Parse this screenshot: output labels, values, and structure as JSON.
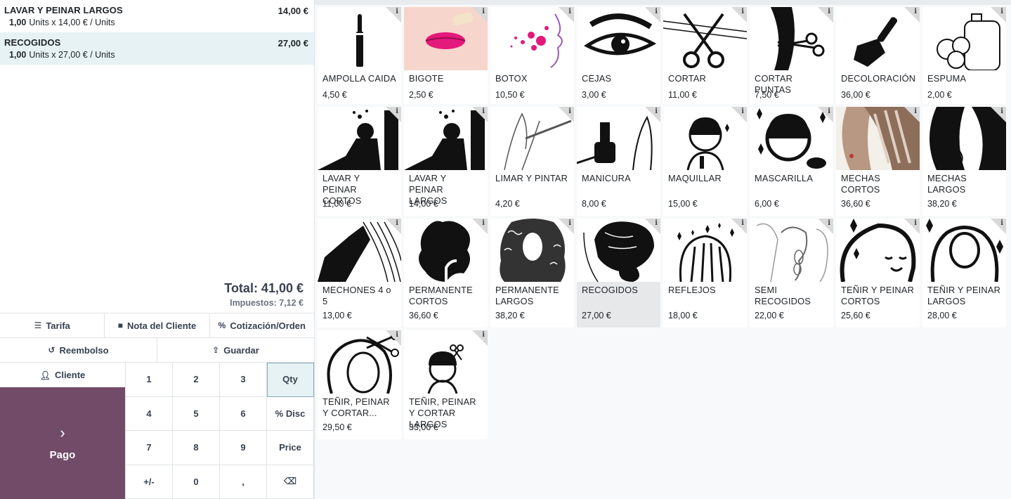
{
  "order": {
    "lines": [
      {
        "name": "LAVAR Y PEINAR LARGOS",
        "price": "14,00 €",
        "qty": "1,00",
        "detail": "Units x 14,00 € / Units",
        "selected": false
      },
      {
        "name": "RECOGIDOS",
        "price": "27,00 €",
        "qty": "1,00",
        "detail": "Units x 27,00 € / Units",
        "selected": true
      }
    ],
    "total": "Total: 41,00 €",
    "taxes": "Impuestos: 7,12 €"
  },
  "controls": {
    "tarifa": "Tarifa",
    "nota": "Nota del Cliente",
    "cotizacion": "Cotización/Orden",
    "reembolso": "Reembolso",
    "guardar": "Guardar",
    "cliente": "Cliente",
    "pago": "Pago"
  },
  "numpad": [
    "1",
    "2",
    "3",
    "Qty",
    "4",
    "5",
    "6",
    "% Disc",
    "7",
    "8",
    "9",
    "Price",
    "+/-",
    "0",
    ",",
    "⌫"
  ],
  "products": [
    {
      "name": "AMPOLLA CAIDA",
      "price": "4,50 €",
      "icon": "ampoule-icon"
    },
    {
      "name": "BIGOTE",
      "price": "2,50 €",
      "icon": "lips-icon"
    },
    {
      "name": "BOTOX",
      "price": "10,50 €",
      "icon": "face-dots-icon"
    },
    {
      "name": "CEJAS",
      "price": "3,00 €",
      "icon": "eye-icon"
    },
    {
      "name": "CORTAR",
      "price": "11,00 €",
      "icon": "scissors-icon"
    },
    {
      "name": "CORTAR PUNTAS",
      "price": "7,50 €",
      "icon": "hair-scissors-icon"
    },
    {
      "name": "DECOLORACIÓN",
      "price": "36,00 €",
      "icon": "brush-icon"
    },
    {
      "name": "ESPUMA",
      "price": "2,00 €",
      "icon": "foam-icon"
    },
    {
      "name": "LAVAR Y PEINAR CORTOS",
      "price": "11,00 €",
      "icon": "hair-wash-icon"
    },
    {
      "name": "LAVAR Y PEINAR LARGOS",
      "price": "14,00 €",
      "icon": "hair-wash-icon"
    },
    {
      "name": "LIMAR Y PINTAR",
      "price": "4,20 €",
      "icon": "nail-file-icon"
    },
    {
      "name": "MANICURA",
      "price": "8,00 €",
      "icon": "nail-polish-icon"
    },
    {
      "name": "MAQUILLAR",
      "price": "15,00 €",
      "icon": "makeup-icon"
    },
    {
      "name": "MASCARILLA",
      "price": "6,00 €",
      "icon": "mask-icon"
    },
    {
      "name": "MECHAS CORTOS",
      "price": "36,60 €",
      "icon": "highlights-icon"
    },
    {
      "name": "MECHAS LARGOS",
      "price": "38,20 €",
      "icon": "long-hair-icon"
    },
    {
      "name": "MECHONES 4 o 5",
      "price": "13,00 €",
      "icon": "hand-hair-icon"
    },
    {
      "name": "PERMANENTE CORTOS",
      "price": "36,60 €",
      "icon": "curly-short-icon"
    },
    {
      "name": "PERMANENTE LARGOS",
      "price": "38,20 €",
      "icon": "curly-long-icon"
    },
    {
      "name": "RECOGIDOS",
      "price": "27,00 €",
      "icon": "bun-icon",
      "selected": true
    },
    {
      "name": "REFLEJOS",
      "price": "18,00 €",
      "icon": "sparkle-hair-icon"
    },
    {
      "name": "SEMI RECOGIDOS",
      "price": "22,00 €",
      "icon": "braid-icon"
    },
    {
      "name": "TEÑIR Y PEINAR CORTOS",
      "price": "25,60 €",
      "icon": "woman-short-icon"
    },
    {
      "name": "TEÑIR Y PEINAR LARGOS",
      "price": "28,00 €",
      "icon": "woman-long-icon"
    },
    {
      "name": "TEÑIR, PEINAR Y CORTAR...",
      "price": "29,50 €",
      "icon": "head-scissors-icon"
    },
    {
      "name": "TEÑIR, PEINAR Y CORTAR LARGOS",
      "price": "33,00 €",
      "icon": "stylist-icon"
    }
  ],
  "info_glyph": "i",
  "colors": {
    "accent": "#714b67",
    "selected_line": "#e6f2f3",
    "selected_card": "#e7e8ea",
    "pink": "#e3197b"
  }
}
